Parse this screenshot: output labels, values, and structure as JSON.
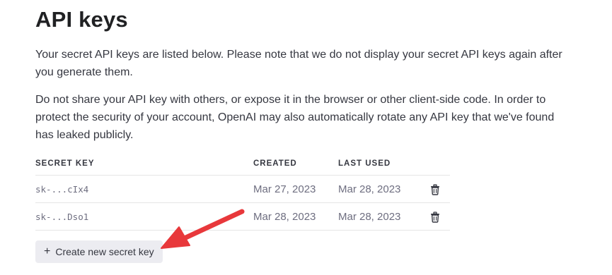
{
  "page": {
    "title": "API keys",
    "description_1": "Your secret API keys are listed below. Please note that we do not display your secret API keys again after you generate them.",
    "description_2": "Do not share your API key with others, or expose it in the browser or other client-side code. In order to protect the security of your account, OpenAI may also automatically rotate any API key that we've found has leaked publicly."
  },
  "table": {
    "headers": {
      "secret_key": "SECRET KEY",
      "created": "CREATED",
      "last_used": "LAST USED"
    },
    "rows": [
      {
        "key": "sk-...cIx4",
        "created": "Mar 27, 2023",
        "last_used": "Mar 28, 2023"
      },
      {
        "key": "sk-...Dso1",
        "created": "Mar 28, 2023",
        "last_used": "Mar 28, 2023"
      }
    ]
  },
  "actions": {
    "create_label": "Create new secret key",
    "create_icon": "plus-icon",
    "delete_icon": "trash-icon"
  },
  "annotation": {
    "arrow_color": "#e8383b"
  }
}
